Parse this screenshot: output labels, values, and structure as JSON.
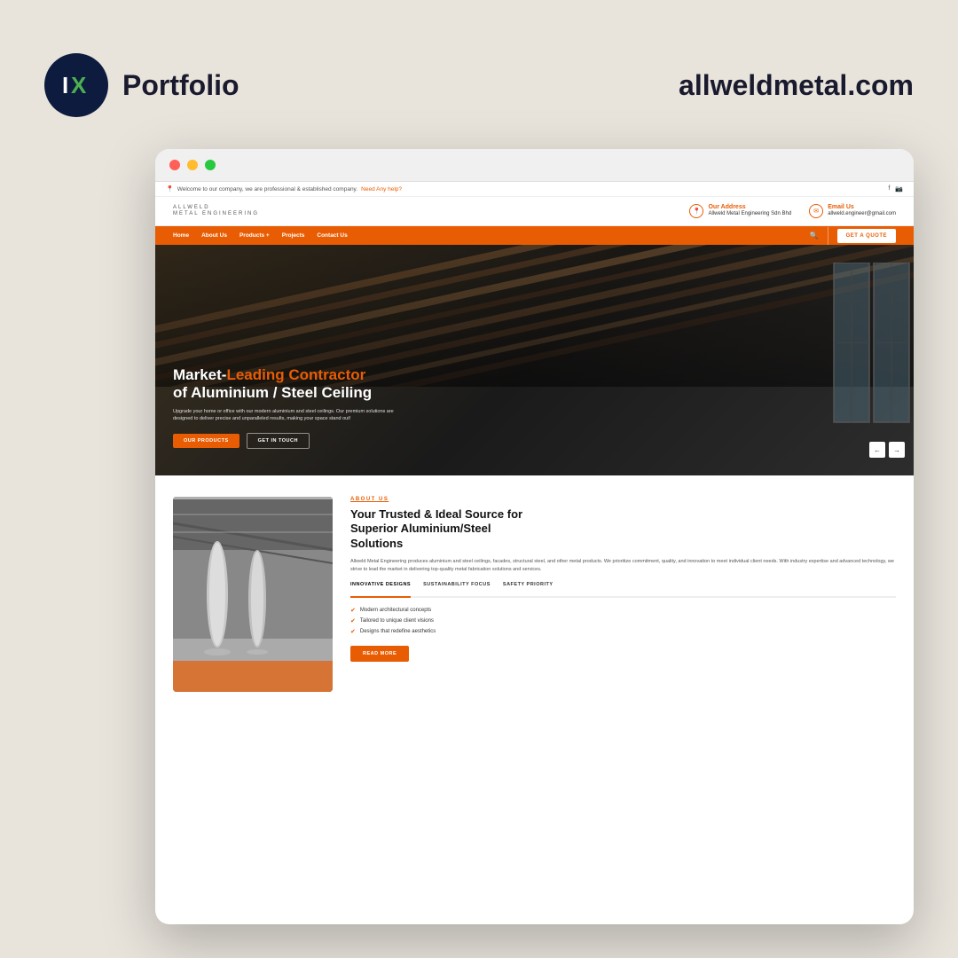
{
  "page": {
    "background": "#e8e4dc"
  },
  "header": {
    "logo_alt": "IX Logo",
    "portfolio_label": "Portfolio",
    "domain": "allweldmetal.com"
  },
  "browser": {
    "dots": [
      "dot1",
      "dot2",
      "dot3"
    ]
  },
  "website": {
    "info_bar": {
      "message": "Welcome to our company, we are professional & established company.",
      "link_text": "Need Any help?",
      "social": [
        "f",
        "🔗"
      ]
    },
    "site_header": {
      "logo_name": "ALLWELD",
      "logo_sub": "METAL ENGINEERING",
      "address_label": "Our Address",
      "address_value": "Allweld Metal Engineering Sdn Bhd",
      "email_label": "Email Us",
      "email_value": "allweld.engineer@gmail.com"
    },
    "nav": {
      "links": [
        "Home",
        "About Us",
        "Products +",
        "Projects",
        "Contact Us"
      ],
      "quote_btn": "GET A QUOTE"
    },
    "hero": {
      "title_start": "Market-",
      "title_highlight": "Leading Contractor",
      "title_end": "of Aluminium / Steel Ceiling",
      "description": "Upgrade your home or office with our modern aluminium and steel ceilings. Our premium solutions are designed to deliver precise and unparalleled results, making your space stand out!",
      "btn_primary": "OUR PRODUCTS",
      "btn_secondary": "GET IN TOUCH"
    },
    "about": {
      "label": "ABOUT US",
      "title_line1": "Your Trusted & Ideal Source for",
      "title_line2": "Superior Aluminium/Steel",
      "title_line3": "Solutions",
      "description": "Allweld Metal Engineering produces aluminium and steel ceilings, facades, structural steel, and other metal products. We prioritize commitment, quality, and innovation to meet individual client needs. With industry expertise and advanced technology, we strive to lead the market in delivering top-quality metal fabrication solutions and services.",
      "tabs": [
        "INNOVATIVE DESIGNS",
        "SUSTAINABILITY FOCUS",
        "SAFETY PRIORITY"
      ],
      "active_tab": 0,
      "checklist": [
        "Modern architectural concepts",
        "Tailored to unique client visions",
        "Designs that redefine aesthetics"
      ],
      "read_more_btn": "READ MORE"
    }
  }
}
